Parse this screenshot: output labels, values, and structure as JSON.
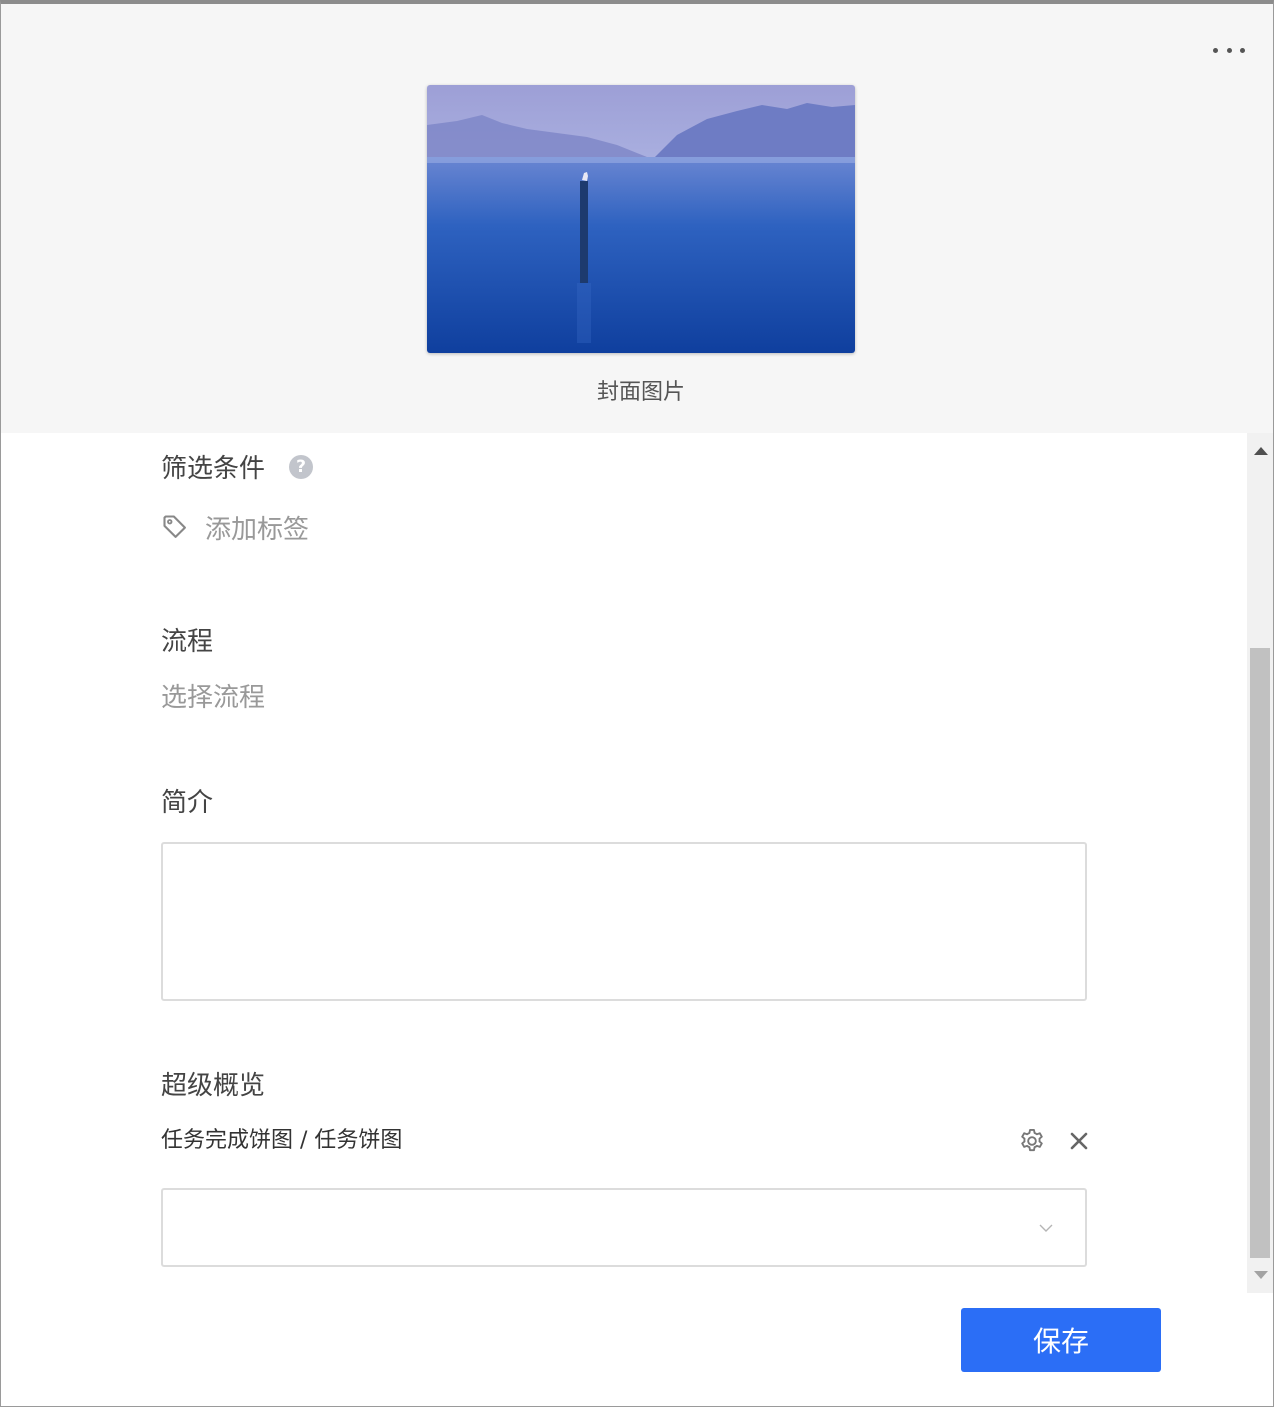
{
  "header": {
    "more_icon": "more-dots-icon",
    "cover_caption": "封面图片"
  },
  "filter": {
    "label": "筛选条件",
    "help_icon": "question-circle-icon",
    "help_glyph": "?",
    "add_tag_icon": "tag-icon",
    "add_tag_label": "添加标签"
  },
  "flow": {
    "label": "流程",
    "placeholder": "选择流程"
  },
  "intro": {
    "label": "简介",
    "value": ""
  },
  "overview": {
    "label": "超级概览",
    "widget_name": "任务完成饼图 / 任务饼图",
    "settings_icon": "gear-icon",
    "remove_icon": "close-icon",
    "dropdown_value": "",
    "dropdown_icon": "chevron-down-icon"
  },
  "footer": {
    "save_label": "保存"
  },
  "colors": {
    "primary": "#2b6ef6",
    "header_bg": "#f6f6f6",
    "placeholder_text": "#999999"
  }
}
